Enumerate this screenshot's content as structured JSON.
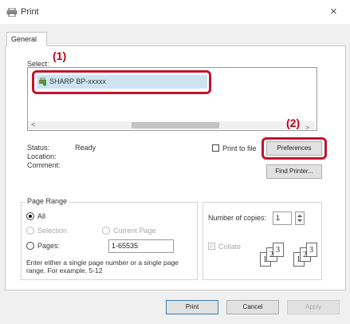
{
  "window": {
    "title": "Print",
    "close_glyph": "×"
  },
  "tabs": [
    {
      "label": "General"
    }
  ],
  "callouts": {
    "one": "(1)",
    "two": "(2)"
  },
  "select_printer": {
    "label": "Select:",
    "selected_printer": "SHARP BP-xxxxx",
    "scroll_left": "<",
    "scroll_right": ">"
  },
  "status": {
    "status_label": "Status:",
    "status_value": "Ready",
    "location_label": "Location:",
    "comment_label": "Comment:"
  },
  "print_to_file": {
    "label": "Print to file",
    "checked": false
  },
  "buttons": {
    "preferences": "Preferences",
    "find_printer": "Find Printer...",
    "print": "Print",
    "cancel": "Cancel",
    "apply": "Apply"
  },
  "page_range": {
    "title": "Page Range",
    "all": "All",
    "selection": "Selection",
    "current_page": "Current Page",
    "pages": "Pages:",
    "pages_value": "1-65535",
    "hint": "Enter either a single page number or a single page range.  For example, 5-12",
    "selected": "All"
  },
  "copies": {
    "label": "Number of copies:",
    "value": "1",
    "collate_label": "Collate",
    "collate_checked": true,
    "collate_pages": [
      "1",
      "2",
      "3"
    ]
  },
  "colors": {
    "callout": "#c0001a",
    "highlight": "#c0142f",
    "selection_bg": "#cde3f4"
  }
}
